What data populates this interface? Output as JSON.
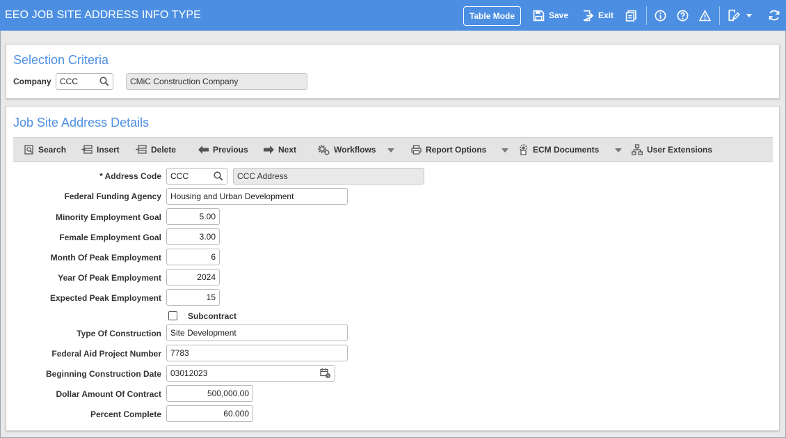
{
  "header": {
    "title": "EEO JOB SITE ADDRESS INFO TYPE",
    "table_mode": "Table Mode",
    "save": "Save",
    "exit": "Exit"
  },
  "selection": {
    "title": "Selection Criteria",
    "company_label": "Company",
    "company_value": "CCC",
    "company_name": "CMiC Construction Company"
  },
  "details": {
    "title": "Job Site Address Details",
    "toolbar": {
      "search": "Search",
      "insert": "Insert",
      "delete": "Delete",
      "previous": "Previous",
      "next": "Next",
      "workflows": "Workflows",
      "report_options": "Report Options",
      "ecm_documents": "ECM Documents",
      "user_extensions": "User Extensions"
    },
    "fields": {
      "address_code_label": "* Address Code",
      "address_code_value": "CCC",
      "address_code_desc": "CCC Address",
      "federal_funding_agency_label": "Federal Funding Agency",
      "federal_funding_agency_value": "Housing and Urban Development",
      "minority_goal_label": "Minority Employment Goal",
      "minority_goal_value": "5.00",
      "female_goal_label": "Female Employment Goal",
      "female_goal_value": "3.00",
      "month_peak_label": "Month Of Peak Employment",
      "month_peak_value": "6",
      "year_peak_label": "Year Of Peak Employment",
      "year_peak_value": "2024",
      "expected_peak_label": "Expected Peak Employment",
      "expected_peak_value": "15",
      "subcontract_label": "Subcontract",
      "type_construction_label": "Type Of Construction",
      "type_construction_value": "Site Development",
      "federal_aid_label": "Federal Aid Project Number",
      "federal_aid_value": "7783",
      "begin_date_label": "Beginning Construction Date",
      "begin_date_value": "03012023",
      "dollar_amount_label": "Dollar Amount Of Contract",
      "dollar_amount_value": "500,000.00",
      "percent_complete_label": "Percent Complete",
      "percent_complete_value": "60.000"
    }
  },
  "colors": {
    "accent": "#4c8fe2",
    "toolbar_bg": "#e4e4e4"
  }
}
